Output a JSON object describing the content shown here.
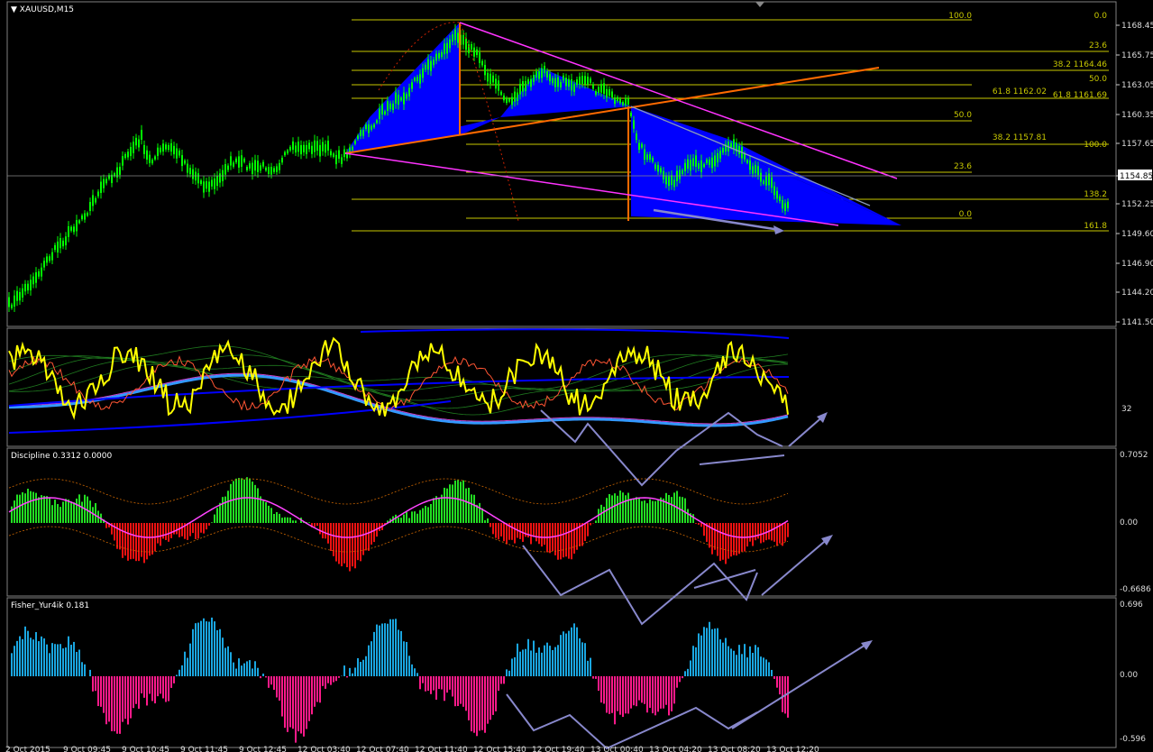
{
  "colors": {
    "bg": "#000000",
    "grid": "#808080",
    "bull_candle": "#00ff00",
    "bear_candle": "#00ff00",
    "fibo": "#c8c800",
    "channel": "#ff33ff",
    "pattern": "#0000ff",
    "trend": "#ff6a00",
    "arrows": "#8888cc",
    "discipline_up": "#22dd22",
    "discipline_dn": "#ee1111",
    "fisher_up": "#1aa6e0",
    "fisher_dn": "#ff1a8a",
    "rsi": "#ffff00"
  },
  "main": {
    "title": "XAUUSD,M15",
    "price_ticks": [
      "1168.45",
      "1165.75",
      "1163.05",
      "1160.35",
      "1157.65",
      "1154.85",
      "1152.25",
      "1149.60",
      "1146.90",
      "1144.20",
      "1141.50"
    ],
    "current_price": "1154.85",
    "fib_labels": [
      {
        "text": "100.0"
      },
      {
        "text": "0.0"
      },
      {
        "text": "23.6"
      },
      {
        "text": "38.2 1164.46"
      },
      {
        "text": "50.0"
      },
      {
        "text": "61.8 1162.02"
      },
      {
        "text": "61.8 1161.69"
      },
      {
        "text": "50.0"
      },
      {
        "text": "38.2 1157.81"
      },
      {
        "text": "100.0"
      },
      {
        "text": "23.6"
      },
      {
        "text": "138.2"
      },
      {
        "text": "0.0"
      },
      {
        "text": "161.8"
      }
    ]
  },
  "rsi_panel": {
    "level_label": "32"
  },
  "discipline_panel": {
    "title": "Discipline 0.3312 0.0000",
    "scale": [
      "0.7052",
      "0.00",
      "-0.6686"
    ]
  },
  "fisher_panel": {
    "title": "Fisher_Yur4ik 0.181",
    "scale": [
      "0.696",
      "0.00",
      "-0.596"
    ]
  },
  "time_axis": [
    "2 Oct 2015",
    "9 Oct 09:45",
    "9 Oct 10:45",
    "9 Oct 11:45",
    "9 Oct 12:45",
    "12 Oct 03:40",
    "12 Oct 07:40",
    "12 Oct 11:40",
    "12 Oct 15:40",
    "12 Oct 19:40",
    "13 Oct 00:40",
    "13 Oct 04:20",
    "13 Oct 08:20",
    "13 Oct 12:20"
  ]
}
